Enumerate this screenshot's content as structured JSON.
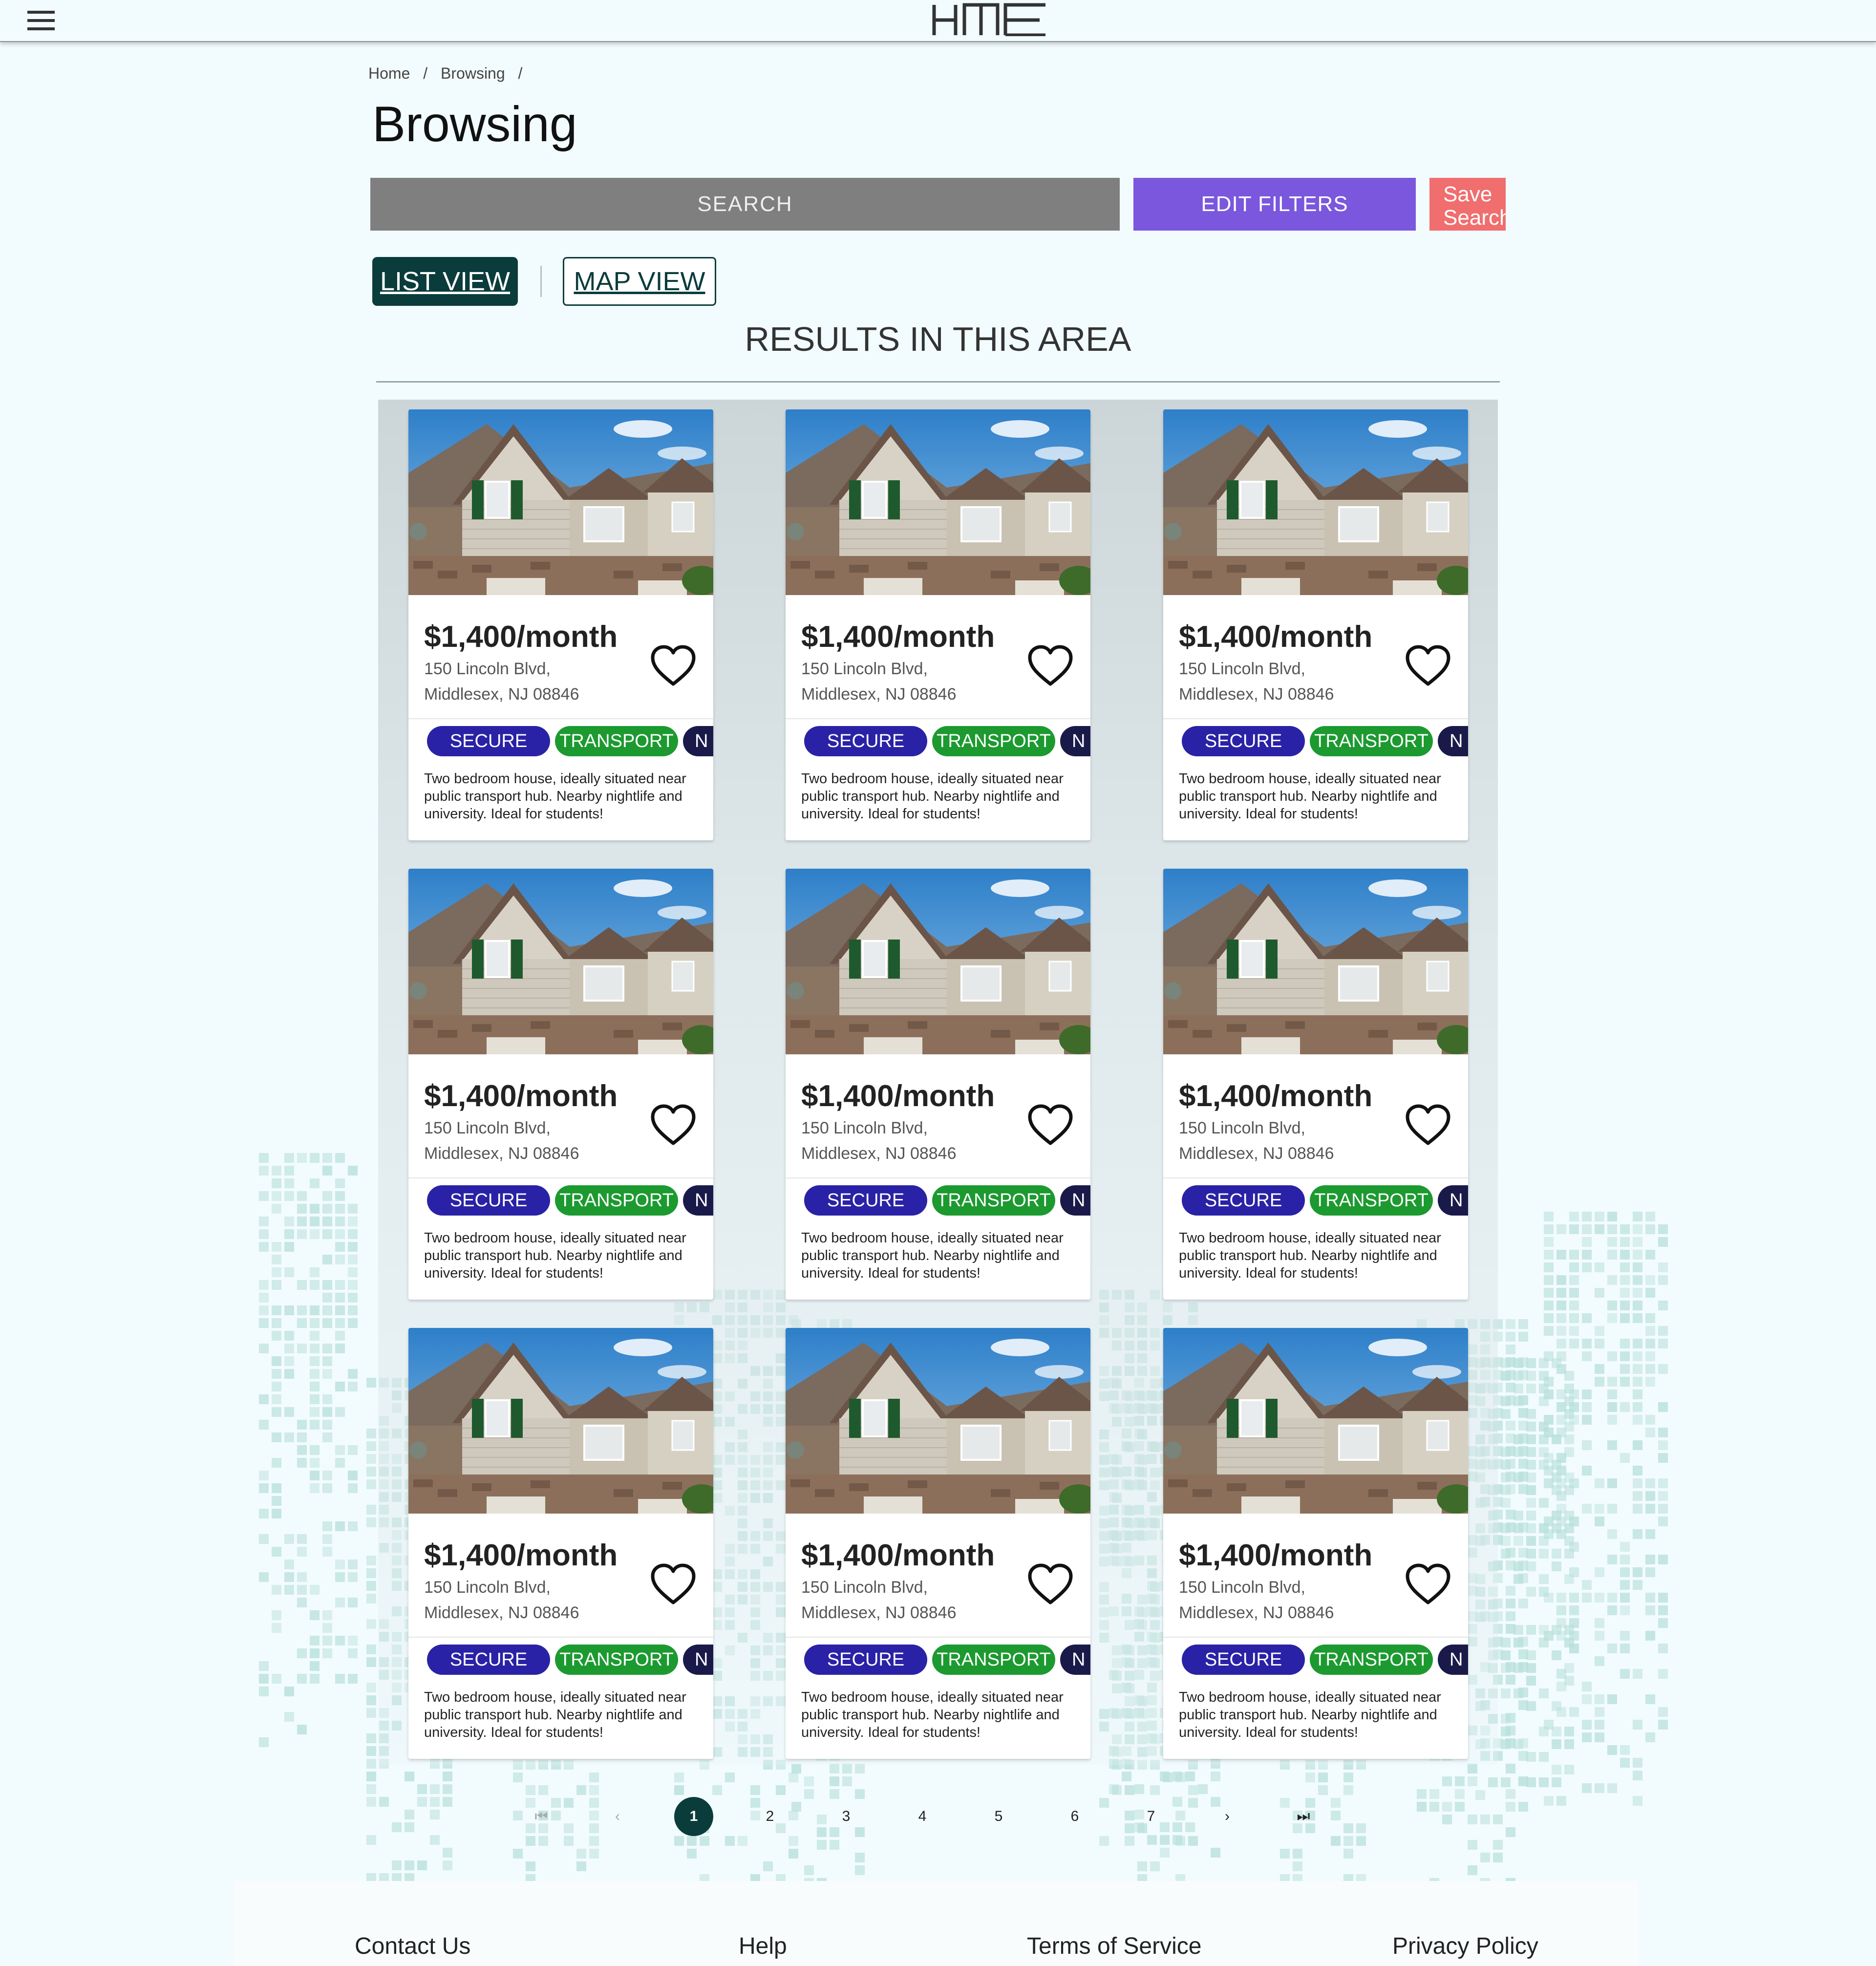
{
  "header": {
    "menu_icon": "hamburger-menu-icon",
    "logo_text": "HME"
  },
  "breadcrumb": [
    "Home",
    "/",
    "Browsing",
    "/"
  ],
  "page": {
    "title": "Browsing",
    "search_label": "SEARCH",
    "edit_filters_label": "EDIT FILTERS",
    "save_search_label": "Save Search",
    "list_view_label": "LIST VIEW",
    "map_view_label": "MAP VIEW",
    "results_heading": "RESULTS IN THIS AREA"
  },
  "colors": {
    "background": "#f2fbfd",
    "search": "#7f7f7f",
    "edit_filters": "#7a57dd",
    "save_search": "#f06e6e",
    "dark_teal": "#0b3c3c",
    "tag_secure": "#2a22a6",
    "tag_transport": "#1c9a30",
    "tag_nightlife": "#1a1a4a"
  },
  "listings": [
    {
      "price": "$1,400/month",
      "address_line1": "150 Lincoln Blvd,",
      "address_line2": "Middlesex, NJ 08846",
      "tags": [
        "SECURE",
        "TRANSPORT",
        "N"
      ],
      "description": "Two bedroom house, ideally situated near public transport hub. Nearby nightlife and university. Ideal for students!"
    },
    {
      "price": "$1,400/month",
      "address_line1": "150 Lincoln Blvd,",
      "address_line2": "Middlesex, NJ 08846",
      "tags": [
        "SECURE",
        "TRANSPORT",
        "N"
      ],
      "description": "Two bedroom house, ideally situated near public transport hub. Nearby nightlife and university. Ideal for students!"
    },
    {
      "price": "$1,400/month",
      "address_line1": "150 Lincoln Blvd,",
      "address_line2": "Middlesex, NJ 08846",
      "tags": [
        "SECURE",
        "TRANSPORT",
        "N"
      ],
      "description": "Two bedroom house, ideally situated near public transport hub. Nearby nightlife and university. Ideal for students!"
    },
    {
      "price": "$1,400/month",
      "address_line1": "150 Lincoln Blvd,",
      "address_line2": "Middlesex, NJ 08846",
      "tags": [
        "SECURE",
        "TRANSPORT",
        "N"
      ],
      "description": "Two bedroom house, ideally situated near public transport hub. Nearby nightlife and university. Ideal for students!"
    },
    {
      "price": "$1,400/month",
      "address_line1": "150 Lincoln Blvd,",
      "address_line2": "Middlesex, NJ 08846",
      "tags": [
        "SECURE",
        "TRANSPORT",
        "N"
      ],
      "description": "Two bedroom house, ideally situated near public transport hub. Nearby nightlife and university. Ideal for students!"
    },
    {
      "price": "$1,400/month",
      "address_line1": "150 Lincoln Blvd,",
      "address_line2": "Middlesex, NJ 08846",
      "tags": [
        "SECURE",
        "TRANSPORT",
        "N"
      ],
      "description": "Two bedroom house, ideally situated near public transport hub. Nearby nightlife and university. Ideal for students!"
    },
    {
      "price": "$1,400/month",
      "address_line1": "150 Lincoln Blvd,",
      "address_line2": "Middlesex, NJ 08846",
      "tags": [
        "SECURE",
        "TRANSPORT",
        "N"
      ],
      "description": "Two bedroom house, ideally situated near public transport hub. Nearby nightlife and university. Ideal for students!"
    },
    {
      "price": "$1,400/month",
      "address_line1": "150 Lincoln Blvd,",
      "address_line2": "Middlesex, NJ 08846",
      "tags": [
        "SECURE",
        "TRANSPORT",
        "N"
      ],
      "description": "Two bedroom house, ideally situated near public transport hub. Nearby nightlife and university. Ideal for students!"
    },
    {
      "price": "$1,400/month",
      "address_line1": "150 Lincoln Blvd,",
      "address_line2": "Middlesex, NJ 08846",
      "tags": [
        "SECURE",
        "TRANSPORT",
        "N"
      ],
      "description": "Two bedroom house, ideally situated near public transport hub. Nearby nightlife and university. Ideal for students!"
    }
  ],
  "pagination": {
    "first_icon": "first-page-icon",
    "prev_icon": "chevron-left-icon",
    "pages": [
      "1",
      "2",
      "3",
      "4",
      "5",
      "6",
      "7"
    ],
    "current": "1",
    "next_icon": "chevron-right-icon",
    "last_icon": "last-page-icon",
    "first_glyph": "⏮",
    "prev_glyph": "‹",
    "next_glyph": "›",
    "last_glyph": "⏭"
  },
  "footer": {
    "links": [
      "Contact Us",
      "Help",
      "Terms of Service",
      "Privacy Policy"
    ]
  }
}
